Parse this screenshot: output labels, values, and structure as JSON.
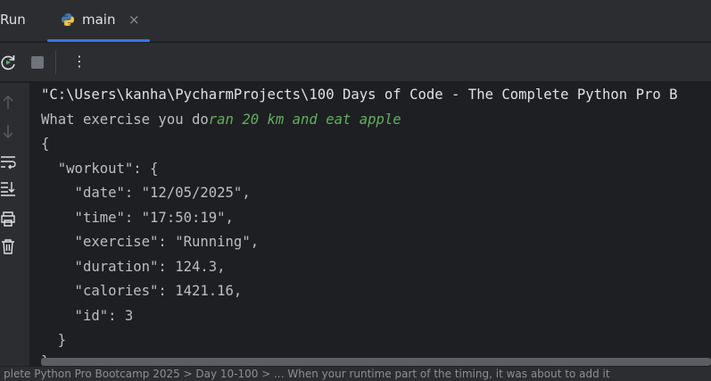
{
  "header": {
    "run_label": "Run",
    "tab_label": "main",
    "tab_close": "×"
  },
  "toolbar": {
    "rerun_icon": "rerun-icon",
    "stop_icon": "stop-icon",
    "more_label": "⋮"
  },
  "gutter": {
    "icons": [
      "arrow-up-icon",
      "arrow-down-icon",
      "soft-wrap-icon",
      "scroll-to-end-icon",
      "print-icon",
      "trash-icon"
    ]
  },
  "console": {
    "command_line": "\"C:\\Users\\kanha\\PycharmProjects\\100 Days of Code - The Complete Python Pro B",
    "prompt": "What exercise you do",
    "user_input": "ran 20 km and eat apple",
    "json_lines": [
      "{",
      "  \"workout\": {",
      "    \"date\": \"12/05/2025\",",
      "    \"time\": \"17:50:19\",",
      "    \"exercise\": \"Running\",",
      "    \"duration\": 124.3,",
      "    \"calories\": 1421.16,",
      "    \"id\": 3",
      "  }",
      "}"
    ]
  },
  "status_bar": {
    "text": "plete Python Pro Bootcamp 2025 > Day 10-100 > ... When your runtime part of the timing, it was about to add it"
  },
  "colors": {
    "accent": "#3574f0",
    "user_input": "#5fb05d",
    "panel": "#2b2d30",
    "console_bg": "#1e1f22"
  }
}
